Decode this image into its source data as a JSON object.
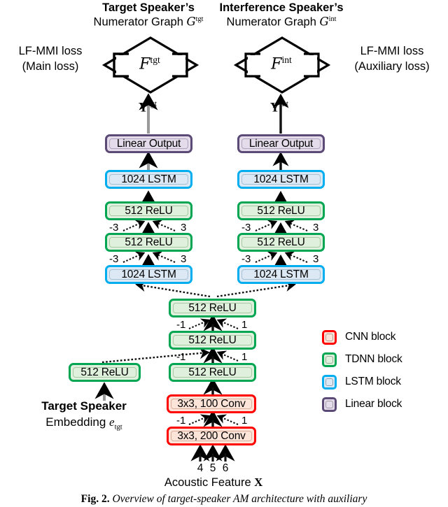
{
  "figure": {
    "caption_label": "Fig. 2.",
    "caption_text": "Overview of target-speaker AM architecture with auxiliary"
  },
  "headers": {
    "target": {
      "line1": "Target Speaker’s",
      "line2_prefix": "Numerator Graph ",
      "symbol": "G",
      "symbol_sup": "tgt"
    },
    "interference": {
      "line1": "Interference Speaker’s",
      "line2_prefix": "Numerator Graph ",
      "symbol": "G",
      "symbol_sup": "int"
    }
  },
  "losses": {
    "left": {
      "line1": "LF-MMI loss",
      "line2": "(Main loss)"
    },
    "right": {
      "line1": "LF-MMI loss",
      "line2": "(Auxiliary loss)"
    }
  },
  "lattices": {
    "left": {
      "symbol": "F",
      "sup": "tgt"
    },
    "right": {
      "symbol": "F",
      "sup": "int"
    }
  },
  "outputs": {
    "left": {
      "symbol": "Y",
      "sup": "tgt"
    },
    "right": {
      "symbol": "Y",
      "sup": "int"
    }
  },
  "embedding": {
    "line1": "Target Speaker",
    "line2_prefix": "Embedding ",
    "symbol": "e",
    "symbol_sub": "tgt"
  },
  "input": {
    "label_prefix": "Acoustic Feature ",
    "label_symbol": "X",
    "offsets": [
      "4",
      "5",
      "6"
    ]
  },
  "branch_left": [
    {
      "label": "Linear Output",
      "kind": "linear"
    },
    {
      "label": "1024 LSTM",
      "kind": "lstm"
    },
    {
      "label": "512 ReLU",
      "kind": "tdnn"
    },
    {
      "label": "512 ReLU",
      "kind": "tdnn"
    },
    {
      "label": "1024 LSTM",
      "kind": "lstm"
    }
  ],
  "branch_right": [
    {
      "label": "Linear Output",
      "kind": "linear"
    },
    {
      "label": "1024 LSTM",
      "kind": "lstm"
    },
    {
      "label": "512 ReLU",
      "kind": "tdnn"
    },
    {
      "label": "512 ReLU",
      "kind": "tdnn"
    },
    {
      "label": "1024 LSTM",
      "kind": "lstm"
    }
  ],
  "trunk": [
    {
      "label": "512 ReLU",
      "kind": "tdnn"
    },
    {
      "label": "512 ReLU",
      "kind": "tdnn"
    },
    {
      "label": "512 ReLU",
      "kind": "tdnn"
    },
    {
      "label": "3x3, 100 Conv",
      "kind": "cnn"
    },
    {
      "label": "3x3, 200 Conv",
      "kind": "cnn"
    }
  ],
  "embedding_block": {
    "label": "512 ReLU",
    "kind": "tdnn"
  },
  "context_labels": {
    "left_branch": [
      {
        "neg": "-3",
        "pos": "3"
      },
      {
        "neg": "-3",
        "pos": "3"
      }
    ],
    "right_branch": [
      {
        "neg": "-3",
        "pos": "3"
      },
      {
        "neg": "-3",
        "pos": "3"
      }
    ],
    "trunk": [
      {
        "neg": "-1",
        "pos": "1"
      },
      {
        "neg": "-1",
        "pos": "1"
      },
      {
        "neg": "-1",
        "pos": "1"
      }
    ]
  },
  "legend": {
    "items": [
      {
        "label": "CNN block",
        "kind": "cnn",
        "border": "#ff0000",
        "fill": "#fde4d8"
      },
      {
        "label": "TDNN block",
        "kind": "tdnn",
        "border": "#00a651",
        "fill": "#dff0dc"
      },
      {
        "label": "LSTM block",
        "kind": "lstm",
        "border": "#00aeef",
        "fill": "#dce9f5"
      },
      {
        "label": "Linear block",
        "kind": "linear",
        "border": "#5b4a76",
        "fill": "#e4dcea"
      }
    ]
  }
}
